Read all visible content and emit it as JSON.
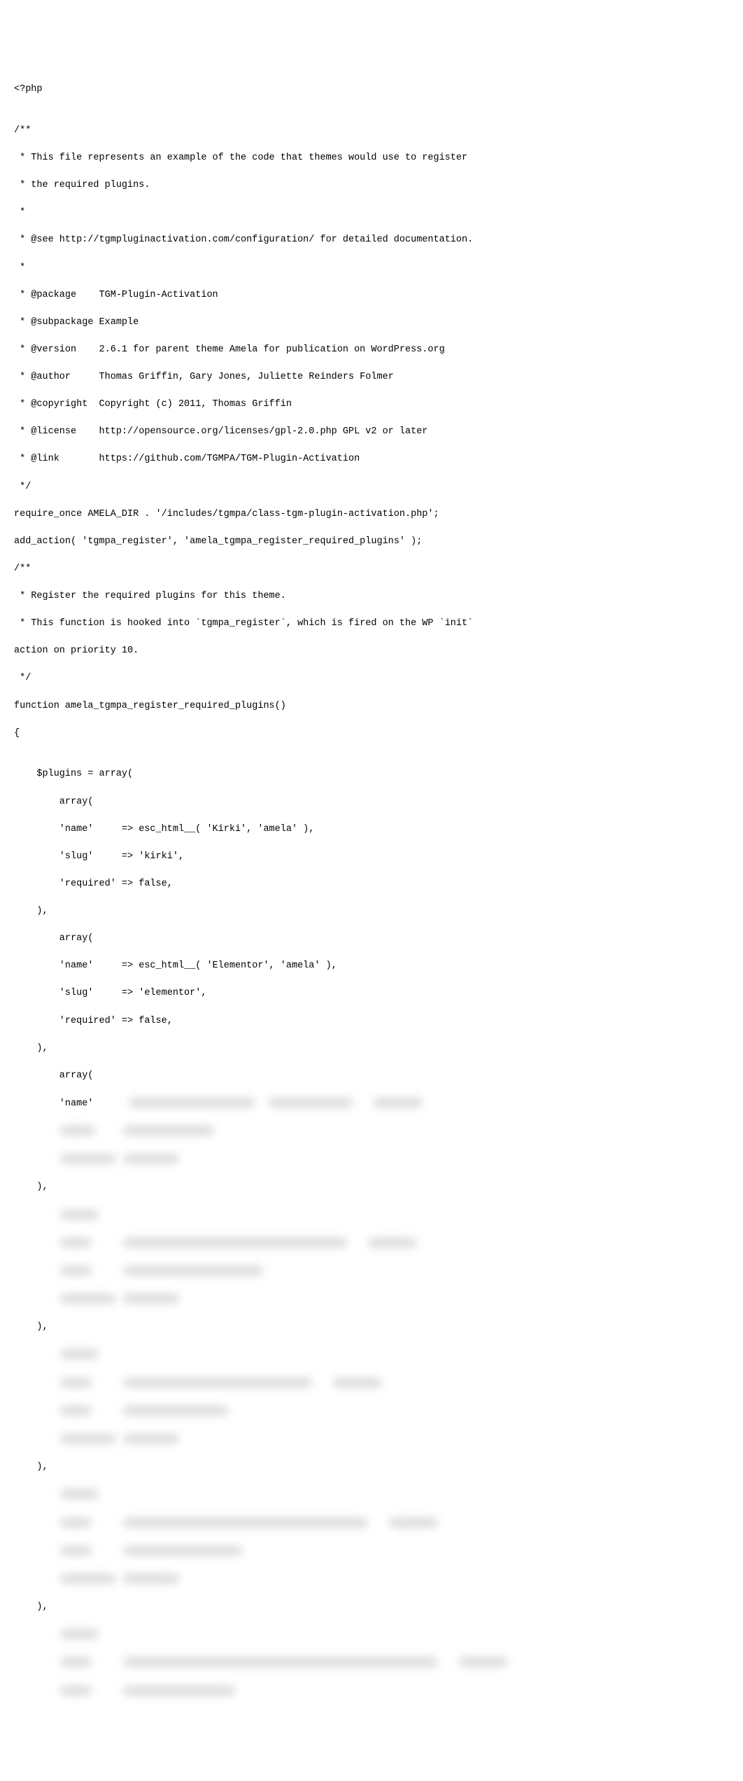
{
  "code": {
    "line1": "<?php",
    "line2": "",
    "line3": "/**",
    "line4": " * This file represents an example of the code that themes would use to register",
    "line5": " * the required plugins.",
    "line6": " *",
    "line7": " * @see http://tgmpluginactivation.com/configuration/ for detailed documentation.",
    "line8": " *",
    "line9": " * @package    TGM-Plugin-Activation",
    "line10": " * @subpackage Example",
    "line11": " * @version    2.6.1 for parent theme Amela for publication on WordPress.org",
    "line12": " * @author     Thomas Griffin, Gary Jones, Juliette Reinders Folmer",
    "line13": " * @copyright  Copyright (c) 2011, Thomas Griffin",
    "line14": " * @license    http://opensource.org/licenses/gpl-2.0.php GPL v2 or later",
    "line15": " * @link       https://github.com/TGMPA/TGM-Plugin-Activation",
    "line16": " */",
    "line17": "require_once AMELA_DIR . '/includes/tgmpa/class-tgm-plugin-activation.php';",
    "line18": "add_action( 'tgmpa_register', 'amela_tgmpa_register_required_plugins' );",
    "line19": "/**",
    "line20": " * Register the required plugins for this theme.",
    "line21": " * This function is hooked into `tgmpa_register`, which is fired on the WP `init` ",
    "line22": "action on priority 10.",
    "line23": " */",
    "line24": "function amela_tgmpa_register_required_plugins()",
    "line25": "{",
    "line26": "",
    "line27": "    $plugins = array(",
    "line28": "        array(",
    "line29": "        'name'     => esc_html__( 'Kirki', 'amela' ),",
    "line30": "        'slug'     => 'kirki',",
    "line31": "        'required' => false,",
    "line32": "    ),",
    "line33": "        array(",
    "line34": "        'name'     => esc_html__( 'Elementor', 'amela' ),",
    "line35": "        'slug'     => 'elementor',",
    "line36": "        'required' => false,",
    "line37": "    ),",
    "line38": "        array(",
    "line39": "        'name'     ",
    "line40_indent": "    ),",
    "line41_indent": "    ),",
    "line42_indent": "    ),",
    "line43_indent": "    ),"
  }
}
